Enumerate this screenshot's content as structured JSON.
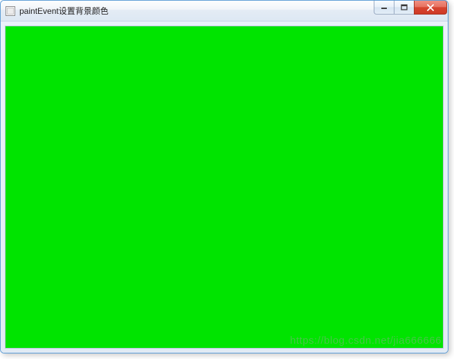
{
  "window": {
    "title": "paintEvent设置背景颜色",
    "background_color": "#00e400"
  },
  "controls": {
    "minimize": "minimize",
    "maximize": "maximize",
    "close": "close"
  },
  "watermark": "https://blog.csdn.net/jia666666"
}
